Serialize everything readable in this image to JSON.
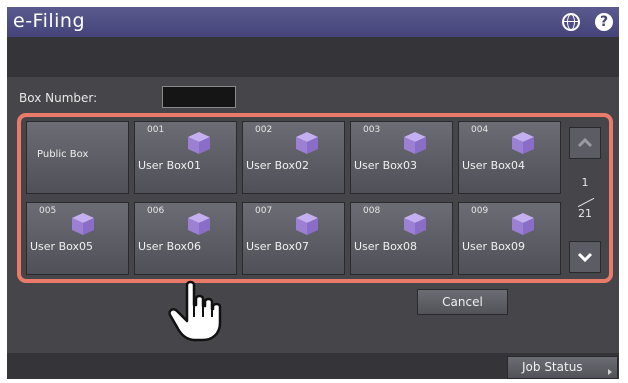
{
  "app": {
    "title": "e-Filing"
  },
  "header": {
    "globe_icon": "globe-icon",
    "help_icon": "help-icon",
    "help_glyph": "?"
  },
  "box_number": {
    "label": "Box Number:",
    "value": ""
  },
  "public_box": {
    "label": "Public Box"
  },
  "boxes": [
    {
      "num": "001",
      "label": "User Box01"
    },
    {
      "num": "002",
      "label": "User Box02"
    },
    {
      "num": "003",
      "label": "User Box03"
    },
    {
      "num": "004",
      "label": "User Box04"
    },
    {
      "num": "005",
      "label": "User Box05"
    },
    {
      "num": "006",
      "label": "User Box06"
    },
    {
      "num": "007",
      "label": "User Box07"
    },
    {
      "num": "008",
      "label": "User Box08"
    },
    {
      "num": "009",
      "label": "User Box09"
    }
  ],
  "pager": {
    "current": "1",
    "total": "21"
  },
  "cancel_label": "Cancel",
  "job_status_label": "Job Status",
  "colors": {
    "accent": "#ea7b6b",
    "titlebar": "#44447a",
    "cube": "#a98fd9"
  }
}
